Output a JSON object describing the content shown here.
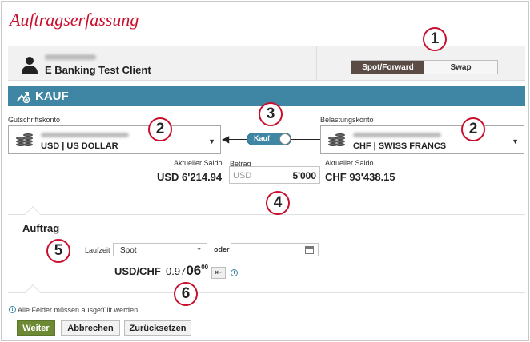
{
  "page": {
    "title": "Auftragserfassung"
  },
  "client": {
    "id_blurred": "■■■■■■■■",
    "name": "E Banking Test Client"
  },
  "mode_switch": {
    "options": [
      "Spot/Forward",
      "Swap"
    ],
    "active": "Spot/Forward"
  },
  "trade": {
    "header": "KAUF"
  },
  "credit_account": {
    "label": "Gutschriftskonto",
    "currency": "USD | US DOLLAR",
    "balance_label": "Aktueller Saldo",
    "balance": "USD 6'214.94"
  },
  "debit_account": {
    "label": "Belastungskonto",
    "currency": "CHF | SWISS FRANCS",
    "balance_label": "Aktueller Saldo",
    "balance": "CHF 93'438.15"
  },
  "direction_toggle": {
    "label": "Kauf"
  },
  "amount": {
    "label": "Betrag",
    "currency": "USD",
    "value": "5'000"
  },
  "order": {
    "title": "Auftrag",
    "term_label": "Laufzeit",
    "term_value": "Spot",
    "or_label": "oder",
    "date_value": "",
    "pair": "USD/CHF",
    "rate_base": "0.97",
    "rate_big": "06",
    "rate_sup": "00"
  },
  "note": {
    "text": "Alle Felder müssen ausgefüllt werden."
  },
  "buttons": {
    "next": "Weiter",
    "cancel": "Abbrechen",
    "reset": "Zurücksetzen"
  },
  "annotations": [
    "1",
    "2",
    "3",
    "2",
    "4",
    "5",
    "6"
  ],
  "colors": {
    "brand_red": "#c8102e",
    "header_blue": "#3e86a4",
    "active_tab": "#5a4b45",
    "primary_button": "#6c8a33"
  },
  "icons": [
    "user-icon",
    "buy-icon",
    "coins-icon",
    "chevron-down-icon",
    "calendar-icon",
    "info-icon",
    "refresh-rate-icon"
  ]
}
